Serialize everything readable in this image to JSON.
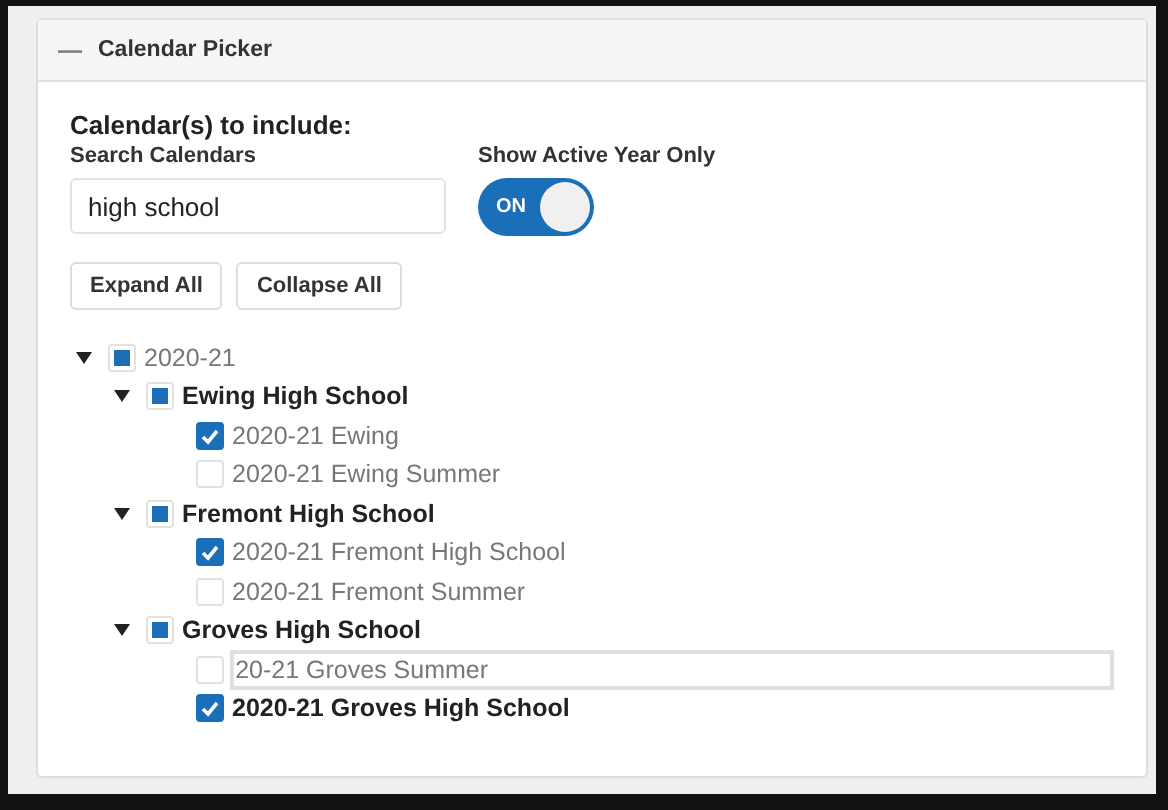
{
  "panel": {
    "title": "Calendar Picker",
    "collapse_icon": "—"
  },
  "heading": "Calendar(s) to include:",
  "search": {
    "label": "Search Calendars",
    "value": "high school"
  },
  "active_year": {
    "label": "Show Active Year Only",
    "on": true,
    "text": "ON"
  },
  "buttons": [
    "Expand All",
    "Collapse All"
  ],
  "tree": [
    {
      "kind": "year",
      "label": "2020-21",
      "expanded": true,
      "checked": false,
      "partial": true,
      "children": [
        {
          "kind": "school",
          "label": "Ewing High School",
          "expanded": true,
          "checked": false,
          "partial": true,
          "children": [
            {
              "kind": "calendar",
              "label": "2020-21 Ewing",
              "checked": true,
              "focused": false,
              "selected": false
            },
            {
              "kind": "calendar",
              "label": "2020-21 Ewing Summer",
              "checked": false,
              "focused": false,
              "selected": false
            }
          ]
        },
        {
          "kind": "school",
          "label": "Fremont High School",
          "expanded": true,
          "checked": false,
          "partial": true,
          "children": [
            {
              "kind": "calendar",
              "label": "2020-21 Fremont High School",
              "checked": true,
              "focused": false,
              "selected": false
            },
            {
              "kind": "calendar",
              "label": "2020-21 Fremont Summer",
              "checked": false,
              "focused": false,
              "selected": false
            }
          ]
        },
        {
          "kind": "school",
          "label": "Groves High School",
          "expanded": true,
          "checked": false,
          "partial": true,
          "children": [
            {
              "kind": "calendar",
              "label": "20-21 Groves Summer",
              "checked": false,
              "focused": true,
              "selected": false
            },
            {
              "kind": "calendar",
              "label": "2020-21 Groves High School",
              "checked": true,
              "focused": false,
              "selected": true
            }
          ]
        }
      ]
    }
  ]
}
